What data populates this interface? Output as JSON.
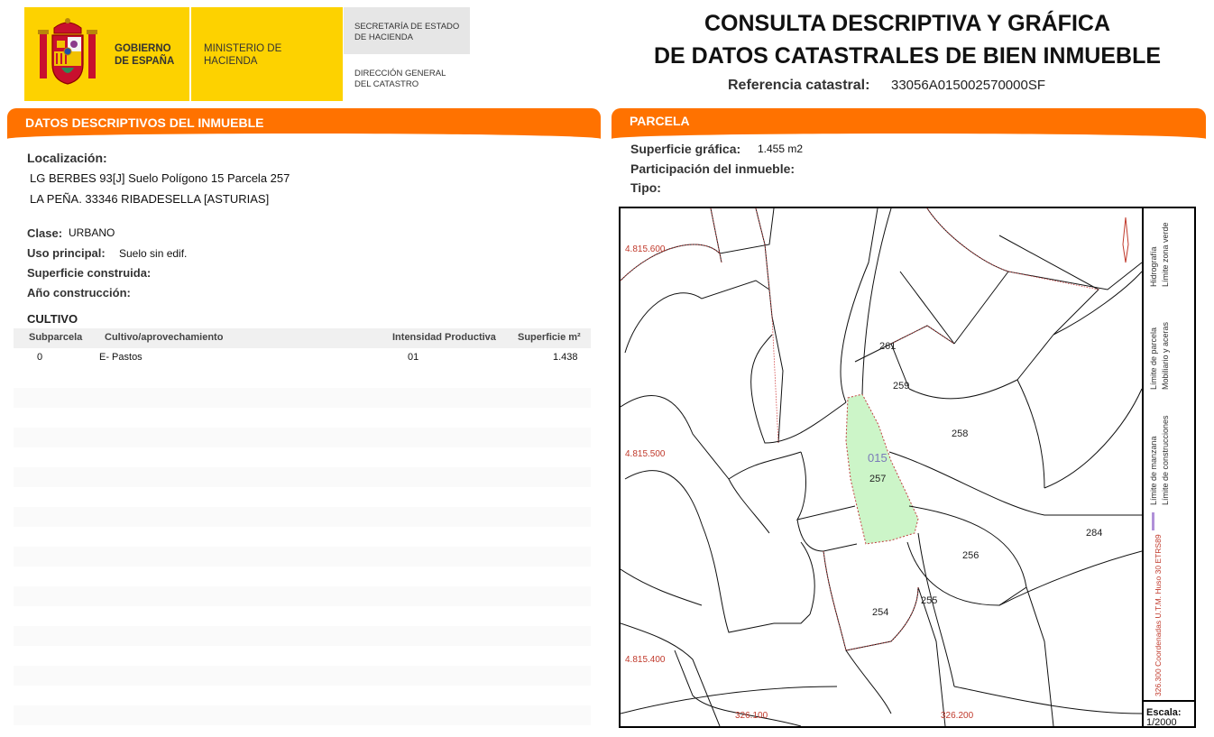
{
  "header": {
    "gov_label": "GOBIERNO DE ESPAÑA",
    "ministry_label": "MINISTERIO DE HACIENDA",
    "secretaria_label": "SECRETARÍA DE ESTADO DE HACIENDA",
    "direccion_label": "DIRECCIÓN GENERAL DEL CATASTRO",
    "title_line1": "CONSULTA DESCRIPTIVA Y GRÁFICA",
    "title_line2": "DE DATOS CATASTRALES DE BIEN INMUEBLE",
    "ref_label": "Referencia catastral:",
    "ref_value": "33056A015002570000SF"
  },
  "descriptivos": {
    "section_title": "DATOS DESCRIPTIVOS DEL INMUEBLE",
    "localizacion_label": "Localización:",
    "localizacion_line1": "LG BERBES 93[J] Suelo Polígono 15 Parcela 257",
    "localizacion_line2": "LA PEÑA. 33346 RIBADESELLA [ASTURIAS]",
    "clase_label": "Clase:",
    "clase_value": "URBANO",
    "uso_label": "Uso principal:",
    "uso_value": "Suelo sin edif.",
    "superficie_label": "Superficie construida:",
    "anio_label": "Año construcción:"
  },
  "cultivo": {
    "title": "CULTIVO",
    "headers": [
      "Subparcela",
      "Cultivo/aprovechamiento",
      "Intensidad Productiva",
      "Superficie m²"
    ],
    "rows": [
      {
        "subparcela": "0",
        "cultivo": "E- Pastos",
        "intensidad": "01",
        "superficie": "1.438"
      }
    ]
  },
  "parcela": {
    "section_title": "PARCELA",
    "superficie_label": "Superficie gráfica:",
    "superficie_value": "1.455 m2",
    "participacion_label": "Participación del inmueble:",
    "tipo_label": "Tipo:"
  },
  "map": {
    "coords_y": [
      "4.815.600",
      "4.815.500",
      "4.815.400"
    ],
    "coords_x": [
      "326.100",
      "326.200"
    ],
    "polygon_label": "015",
    "parcel_labels": [
      "261",
      "259",
      "258",
      "257",
      "284",
      "256",
      "255",
      "254"
    ],
    "legend": {
      "limite_manzana": "Límite de manzana",
      "limite_construcciones": "Límite de construcciones",
      "limite_parcela": "Límite de parcela",
      "mobiliario": "Mobiliario y aceras",
      "hidrografia": "Hidrografía",
      "zona_verde": "Límite zona verde",
      "coordenadas": "326.300 Coordenadas U.T.M. Huso 30 ETRS89"
    },
    "scale_label": "Escala:",
    "scale_value": "1/2000",
    "colors": {
      "highlight_fill": "#ccf5c8",
      "parcel_line": "#111111",
      "construction_line": "#d04040",
      "manzana": "#b090d8",
      "hidrografia": "#8080d0",
      "zona_verde": "#80d0a0"
    }
  }
}
